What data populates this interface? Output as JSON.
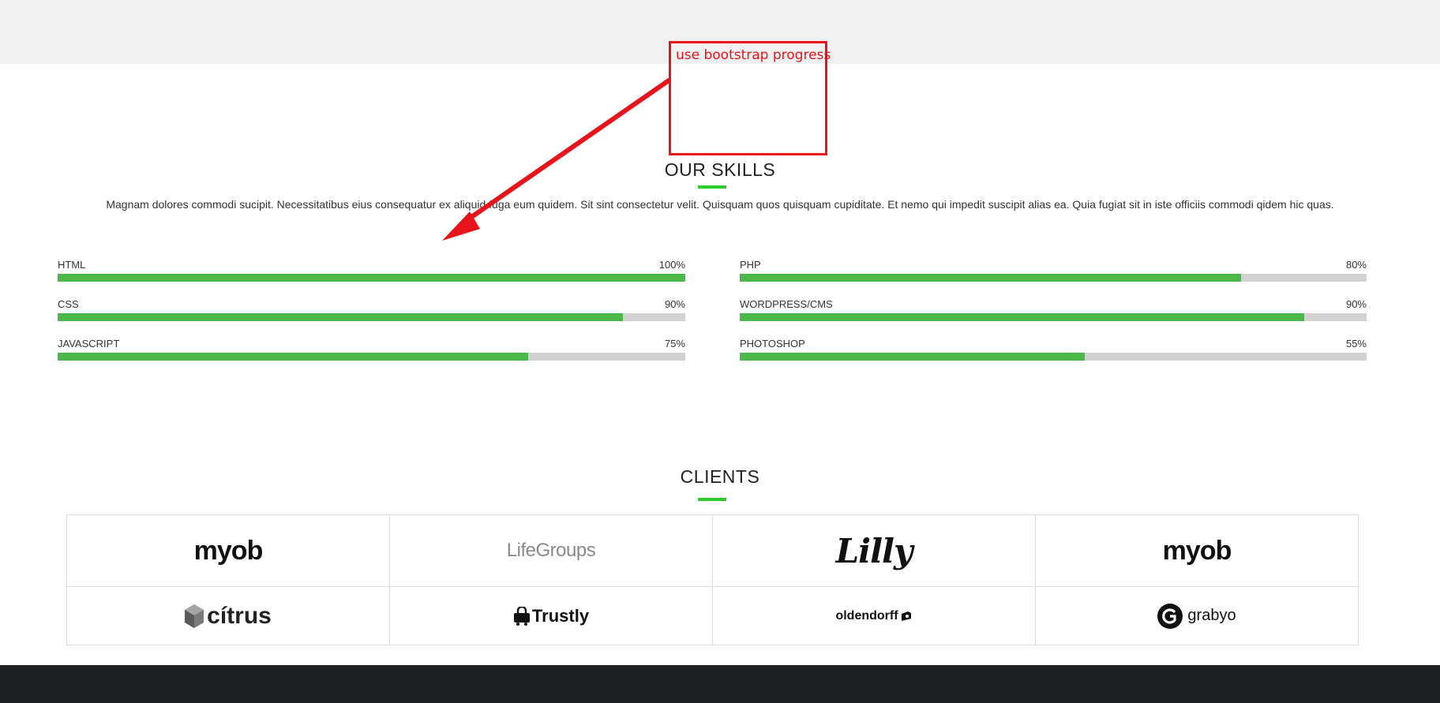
{
  "skills": {
    "title": "OUR SKILLS",
    "intro": "Magnam dolores commodi sucipit. Necessitatibus eius consequatur ex aliquid fuga eum quidem. Sit sint consectetur velit. Quisquam quos quisquam cupiditate. Et nemo qui impedit suscipit alias ea. Quia fugiat sit in iste officiis commodi qidem hic quas.",
    "left": [
      {
        "label": "HTML",
        "percent_text": "100%",
        "percent": 100
      },
      {
        "label": "CSS",
        "percent_text": "90%",
        "percent": 90
      },
      {
        "label": "JAVASCRIPT",
        "percent_text": "75%",
        "percent": 75
      }
    ],
    "right": [
      {
        "label": "PHP",
        "percent_text": "80%",
        "percent": 80
      },
      {
        "label": "WORDPRESS/CMS",
        "percent_text": "90%",
        "percent": 90
      },
      {
        "label": "PHOTOSHOP",
        "percent_text": "55%",
        "percent": 55
      }
    ],
    "bar_color": "#4cb848",
    "track_color": "#d2d2d2",
    "accent_color": "#2ecc2e"
  },
  "clients": {
    "title": "CLIENTS",
    "logos": [
      {
        "name": "myob",
        "text": "myob"
      },
      {
        "name": "lifegroups",
        "text": "LifeGroups"
      },
      {
        "name": "lilly",
        "text": "Lilly"
      },
      {
        "name": "myob",
        "text": "myob"
      },
      {
        "name": "citrus",
        "text": "cítrus"
      },
      {
        "name": "trustly",
        "text": "Trustly"
      },
      {
        "name": "oldendorff",
        "text": "oldendorff"
      },
      {
        "name": "grabyo",
        "text": "grabyo"
      }
    ]
  },
  "annotation": {
    "text": "use bootstrap progress",
    "color": "#e8141b"
  }
}
